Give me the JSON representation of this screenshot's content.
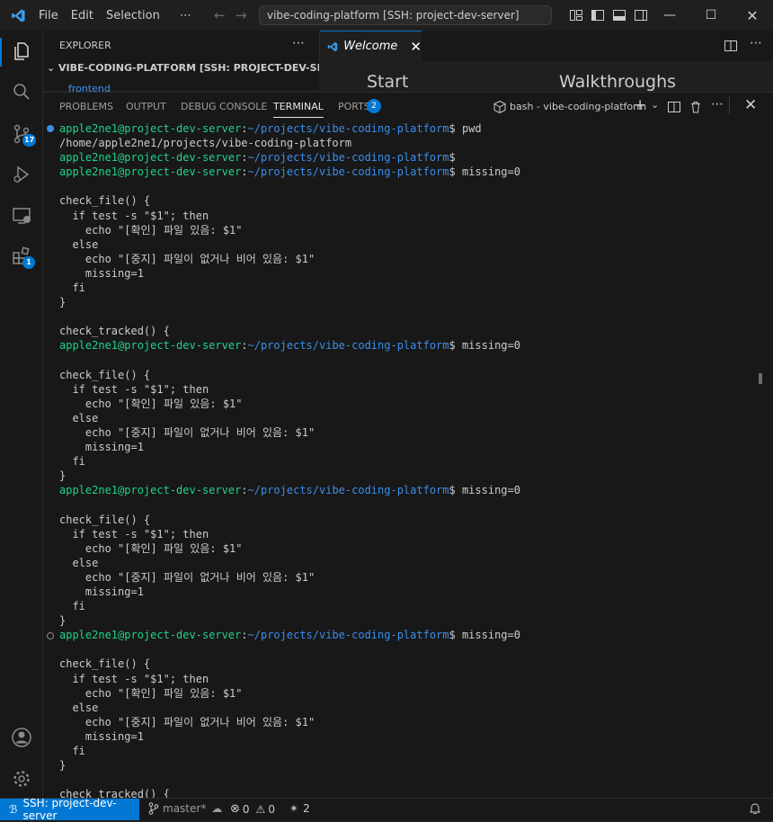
{
  "title_bar": {
    "menu": [
      "File",
      "Edit",
      "Selection",
      "⋯"
    ],
    "command_center": "vibe-coding-platform [SSH: project-dev-server]"
  },
  "sidebar": {
    "header": "EXPLORER",
    "more": "⋯",
    "root": "VIBE-CODING-PLATFORM [SSH: PROJECT-DEV-SERVER]",
    "first_item": "frontend"
  },
  "activity_badges": {
    "source_control": "17",
    "extensions": "1"
  },
  "editor": {
    "tab_label": "Welcome",
    "heading_start": "Start",
    "heading_walkthroughs": "Walkthroughs"
  },
  "panel": {
    "tabs": [
      "PROBLEMS",
      "OUTPUT",
      "DEBUG CONSOLE",
      "TERMINAL",
      "PORTS"
    ],
    "ports_count": "2",
    "terminal_name": "bash - vibe-coding-platform"
  },
  "terminal": {
    "user_host": "apple2ne1@project-dev-server",
    "path": "~/projects/vibe-coding-platform",
    "lines": [
      {
        "kind": "prompt",
        "cmd": " pwd",
        "marker": "blue"
      },
      {
        "kind": "out",
        "text": "/home/apple2ne1/projects/vibe-coding-platform"
      },
      {
        "kind": "prompt",
        "cmd": ""
      },
      {
        "kind": "prompt",
        "cmd": " missing=0"
      },
      {
        "kind": "out",
        "text": ""
      },
      {
        "kind": "out",
        "text": "check_file() {"
      },
      {
        "kind": "out",
        "text": "  if test -s \"$1\"; then"
      },
      {
        "kind": "out",
        "text": "    echo \"[확인] 파일 있음: $1\""
      },
      {
        "kind": "out",
        "text": "  else"
      },
      {
        "kind": "out",
        "text": "    echo \"[중지] 파일이 없거나 비어 있음: $1\""
      },
      {
        "kind": "out",
        "text": "    missing=1"
      },
      {
        "kind": "out",
        "text": "  fi"
      },
      {
        "kind": "out",
        "text": "}"
      },
      {
        "kind": "out",
        "text": ""
      },
      {
        "kind": "out",
        "text": "check_tracked() {"
      },
      {
        "kind": "prompt",
        "cmd": " missing=0"
      },
      {
        "kind": "out",
        "text": ""
      },
      {
        "kind": "out",
        "text": "check_file() {"
      },
      {
        "kind": "out",
        "text": "  if test -s \"$1\"; then"
      },
      {
        "kind": "out",
        "text": "    echo \"[확인] 파일 있음: $1\""
      },
      {
        "kind": "out",
        "text": "  else"
      },
      {
        "kind": "out",
        "text": "    echo \"[중지] 파일이 없거나 비어 있음: $1\""
      },
      {
        "kind": "out",
        "text": "    missing=1"
      },
      {
        "kind": "out",
        "text": "  fi"
      },
      {
        "kind": "out",
        "text": "}"
      },
      {
        "kind": "prompt",
        "cmd": " missing=0"
      },
      {
        "kind": "out",
        "text": ""
      },
      {
        "kind": "out",
        "text": "check_file() {"
      },
      {
        "kind": "out",
        "text": "  if test -s \"$1\"; then"
      },
      {
        "kind": "out",
        "text": "    echo \"[확인] 파일 있음: $1\""
      },
      {
        "kind": "out",
        "text": "  else"
      },
      {
        "kind": "out",
        "text": "    echo \"[중지] 파일이 없거나 비어 있음: $1\""
      },
      {
        "kind": "out",
        "text": "    missing=1"
      },
      {
        "kind": "out",
        "text": "  fi"
      },
      {
        "kind": "out",
        "text": "}"
      },
      {
        "kind": "prompt",
        "cmd": " missing=0",
        "marker": "hollow"
      },
      {
        "kind": "out",
        "text": ""
      },
      {
        "kind": "out",
        "text": "check_file() {"
      },
      {
        "kind": "out",
        "text": "  if test -s \"$1\"; then"
      },
      {
        "kind": "out",
        "text": "    echo \"[확인] 파일 있음: $1\""
      },
      {
        "kind": "out",
        "text": "  else"
      },
      {
        "kind": "out",
        "text": "    echo \"[중지] 파일이 없거나 비어 있음: $1\""
      },
      {
        "kind": "out",
        "text": "    missing=1"
      },
      {
        "kind": "out",
        "text": "  fi"
      },
      {
        "kind": "out",
        "text": "}"
      },
      {
        "kind": "out",
        "text": ""
      },
      {
        "kind": "out",
        "text": "check_tracked() {"
      }
    ]
  },
  "status_bar": {
    "remote": "SSH: project-dev-server",
    "branch": "master*",
    "errors": "0",
    "warnings": "0",
    "ports": "2"
  },
  "colors": {
    "accent": "#0078d4",
    "prompt_user": "#23d18b",
    "prompt_path": "#3b8eea",
    "background": "#181818"
  }
}
